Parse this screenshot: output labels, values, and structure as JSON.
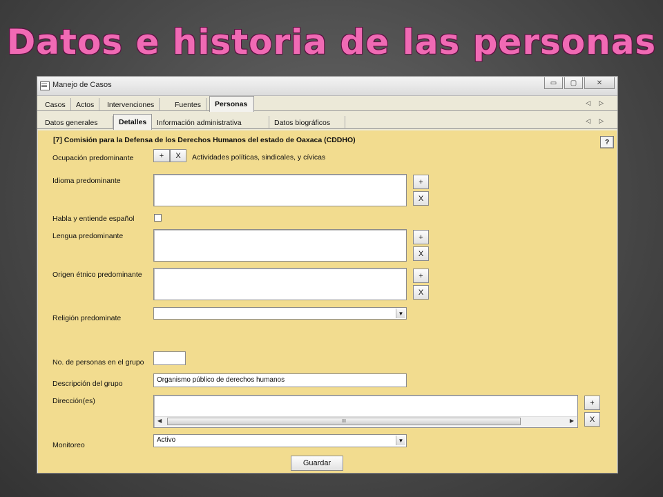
{
  "slide": {
    "title": "Datos e historia de las personas"
  },
  "window": {
    "title": "Manejo de Casos",
    "controls": {
      "minimize": "▭",
      "maximize": "▢",
      "close": "✕"
    }
  },
  "tabs_main": [
    "Casos",
    "Actos",
    "Intervenciones",
    "Fuentes",
    "Personas"
  ],
  "tabs_main_active": "Personas",
  "tabs_sub": [
    "Datos generales",
    "Detalles",
    "Información administrativa",
    "Datos biográficos"
  ],
  "tabs_sub_active": "Detalles",
  "tab_arrows": {
    "left": "◁",
    "right": "▷"
  },
  "form": {
    "org_title": "[7] Comisión para la Defensa de los Derechos Humanos del estado de Oaxaca (CDDHO)",
    "help_label": "?",
    "add_label": "+",
    "remove_label": "X",
    "ocupacion": {
      "label": "Ocupación predominante",
      "value": "Actividades políticas, sindicales, y cívicas"
    },
    "idioma": {
      "label": "Idioma predominante"
    },
    "habla_espanol": {
      "label": "Habla y entiende español",
      "checked": false
    },
    "lengua": {
      "label": "Lengua predominante"
    },
    "origen": {
      "label": "Origen étnico predominante"
    },
    "religion": {
      "label": "Religión predominate",
      "value": ""
    },
    "num_personas": {
      "label": "No. de personas en el grupo",
      "value": ""
    },
    "descripcion": {
      "label": "Descripción del grupo",
      "value": "Organismo público de derechos humanos"
    },
    "direccion": {
      "label": "Dirección(es)",
      "scroll_grip": "III"
    },
    "monitoreo": {
      "label": "Monitoreo",
      "value": "Activo"
    },
    "save_label": "Guardar"
  },
  "colors": {
    "panel": "#f2dc8f",
    "title": "#f06ab4"
  }
}
